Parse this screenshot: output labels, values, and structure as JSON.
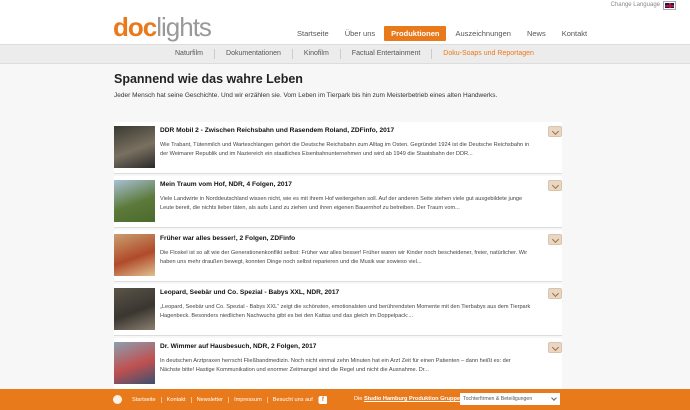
{
  "header": {
    "change_language": "Change Language",
    "logo_a": "doc",
    "logo_b": "lights"
  },
  "main_nav": [
    {
      "label": "Startseite",
      "active": false
    },
    {
      "label": "Über uns",
      "active": false
    },
    {
      "label": "Produktionen",
      "active": true
    },
    {
      "label": "Auszeichnungen",
      "active": false
    },
    {
      "label": "News",
      "active": false
    },
    {
      "label": "Kontakt",
      "active": false
    }
  ],
  "sub_nav": [
    {
      "label": "Naturfilm",
      "active": false
    },
    {
      "label": "Dokumentationen",
      "active": false
    },
    {
      "label": "Kinofilm",
      "active": false
    },
    {
      "label": "Factual Entertainment",
      "active": false
    },
    {
      "label": "Doku-Soaps und Reportagen",
      "active": true
    }
  ],
  "page": {
    "title": "Spannend wie das wahre Leben",
    "intro": "Jeder Mensch hat seine Geschichte. Und wir erzählen sie. Vom Leben im Tierpark bis hin zum Meisterbetrieb eines alten Handwerks."
  },
  "entries": [
    {
      "title": "DDR Mobil 2 - Zwischen Reichsbahn und Rasendem Roland, ZDFinfo, 2017",
      "text": "Wie Trabant, Tütenmilch und Warteschlangen gehört die Deutsche Reichsbahn zum Alltag im Osten. Gegründet 1924 ist die Deutsche Reichsbahn in der Weimarer Republik und im Naziereich ein staatliches Eisenbahnunternehmen und wird ab 1949 die Staatsbahn der DDR...",
      "thumb_colors": [
        "#3a3a32",
        "#7a7060",
        "#2a2a2a"
      ]
    },
    {
      "title": "Mein Traum vom Hof, NDR, 4 Folgen, 2017",
      "text": "Viele Landwirte in Norddeutschland wissen nicht, wie es mit ihrem Hof weitergehen soll. Auf der anderen Seite stehen viele gut ausgebildete junge Leute bereit, die nichts lieber täten, als aufs Land zu ziehen und ihren eigenen Bauernhof zu betreiben. Der Traum vom...",
      "thumb_colors": [
        "#a8c0d6",
        "#5c7a3a",
        "#4a6a2c"
      ]
    },
    {
      "title": "Früher war alles besser!, 2 Folgen, ZDFinfo",
      "text": "Die Floskel ist so alt wie der Generationenkonflikt selbst: Früher war alles besser! Früher waren wir Kinder noch bescheidener, freier, natürlicher. Wir haben uns mehr draußen bewegt, konnten Dinge noch selbst reparieren und die Musik war sowieso viel...",
      "thumb_colors": [
        "#c9a070",
        "#b04a2a",
        "#e0c090"
      ]
    },
    {
      "title": "Leopard, Seebär und Co. Spezial - Babys XXL, NDR, 2017",
      "text": "„Leopard, Seebär und Co. Spezial - Babys XXL“ zeigt die schönsten, emotionalsten und berührendsten Momente mit den Tierbabys aus dem Tierpark Hagenbeck. Besonders niedlichen Nachwuchs gibt es bei den Kattas und das gleich im Doppelpack:...",
      "thumb_colors": [
        "#5a5448",
        "#3a3630",
        "#8a8070"
      ]
    },
    {
      "title": "Dr. Wimmer auf Hausbesuch, NDR, 2 Folgen, 2017",
      "text": "In deutschen Arztpraxen herrscht Fließbandmedizin. Noch nicht einmal zehn Minuten hat ein Arzt Zeit für einen Patienten – dann heißt es: der Nächste bitte! Hastige Kommunikation und enormer Zeitmangel sind die Regel und nicht die Ausnahme. Dr...",
      "thumb_colors": [
        "#8aa0b0",
        "#c05050",
        "#3a5070"
      ]
    }
  ],
  "footer": {
    "links": [
      "Startseite",
      "Kontakt",
      "Newsletter",
      "Impressum",
      "Besucht uns auf"
    ],
    "fb_glyph": "f",
    "group_prefix": "Die ",
    "group_link": "Studio Hamburg Produktion Gruppe:",
    "select_value": "Tochterfirmen & Beteiligungen"
  }
}
